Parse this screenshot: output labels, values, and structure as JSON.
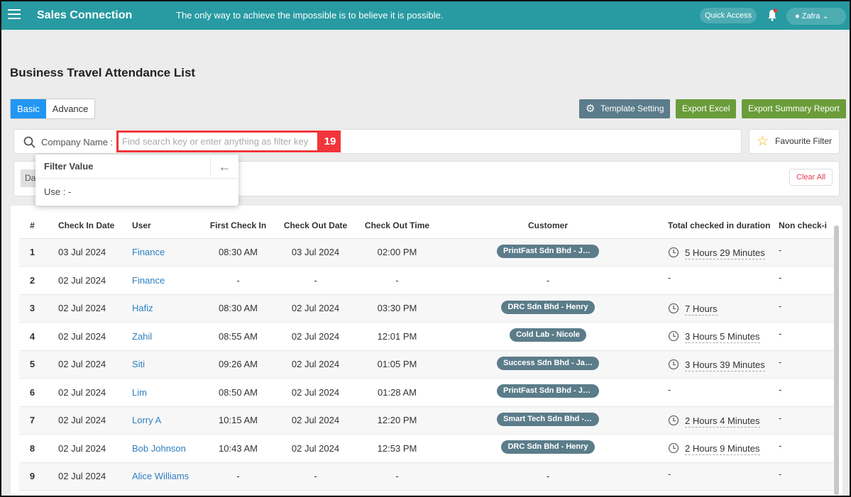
{
  "header": {
    "app_title": "Sales Connection",
    "quote": "The only way to achieve the impossible is to believe it is possible.",
    "quick_access": "Quick Access",
    "user": "Zafra"
  },
  "page_title": "Business Travel Attendance List",
  "tabs": [
    {
      "label": "Basic",
      "active": true
    },
    {
      "label": "Advance",
      "active": false
    }
  ],
  "toolbar": {
    "template_setting": "Template Setting",
    "export_excel": "Export Excel",
    "export_summary": "Export Summary Report"
  },
  "search": {
    "label": "Company Name :",
    "placeholder": "Find search key or enter anything as filter key",
    "badge": "19"
  },
  "favourite_filter": "Favourite Filter",
  "filter_chip": "Da",
  "clear_all": "Clear All",
  "filter_popup": {
    "title": "Filter Value",
    "value": "Use : -"
  },
  "colors": {
    "topbar": "#279aa2",
    "primary": "#2196f3",
    "export": "#6a9d3a",
    "template": "#5b7c8a",
    "badge": "#f2353b"
  },
  "table": {
    "columns": [
      "#",
      "Check In Date",
      "User",
      "First Check In",
      "Check Out Date",
      "Check Out Time",
      "Customer",
      "Total checked in duration",
      "Non check-i"
    ],
    "rows": [
      [
        "1",
        "03 Jul 2024",
        "Finance",
        "08:30 AM",
        "03 Jul 2024",
        "02:00 PM",
        "PrintFast Sdn Bhd - Joh...",
        "5 Hours 29 Minutes",
        "-"
      ],
      [
        "2",
        "02 Jul 2024",
        "Finance",
        "-",
        "-",
        "-",
        "-",
        "-",
        "-"
      ],
      [
        "3",
        "02 Jul 2024",
        "Hafiz",
        "08:30 AM",
        "02 Jul 2024",
        "03:30 PM",
        "DRC Sdn Bhd - Henry",
        "7 Hours",
        "-"
      ],
      [
        "4",
        "02 Jul 2024",
        "Zahil",
        "08:55 AM",
        "02 Jul 2024",
        "12:01 PM",
        "Cold Lab - Nicole",
        "3 Hours 5 Minutes",
        "-"
      ],
      [
        "5",
        "02 Jul 2024",
        "Siti",
        "09:26 AM",
        "02 Jul 2024",
        "01:05 PM",
        "Success Sdn Bhd - Jam...",
        "3 Hours 39 Minutes",
        "-"
      ],
      [
        "6",
        "02 Jul 2024",
        "Lim",
        "08:50 AM",
        "02 Jul 2024",
        "01:28 AM",
        "PrintFast Sdn Bhd - Joh...",
        "-",
        "-"
      ],
      [
        "7",
        "02 Jul 2024",
        "Lorry A",
        "10:15 AM",
        "02 Jul 2024",
        "12:20 PM",
        "Smart Tech Sdn Bhd - J...",
        "2 Hours 4 Minutes",
        "-"
      ],
      [
        "8",
        "02 Jul 2024",
        "Bob Johnson",
        "10:43 AM",
        "02 Jul 2024",
        "12:53 PM",
        "DRC Sdn Bhd - Henry",
        "2 Hours 9 Minutes",
        "-"
      ],
      [
        "9",
        "02 Jul 2024",
        "Alice Williams",
        "-",
        "-",
        "-",
        "-",
        "-",
        "-"
      ]
    ]
  }
}
